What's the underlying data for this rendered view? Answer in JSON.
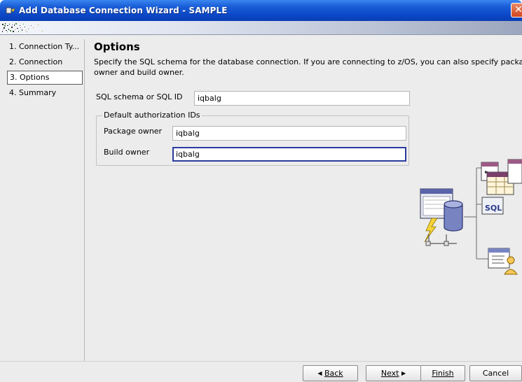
{
  "window": {
    "title": "Add Database Connection Wizard - SAMPLE",
    "close_glyph": "✕"
  },
  "nav": {
    "items": [
      {
        "label": "1. Connection Ty...",
        "selected": false
      },
      {
        "label": "2. Connection",
        "selected": false
      },
      {
        "label": "3. Options",
        "selected": true
      },
      {
        "label": "4. Summary",
        "selected": false
      }
    ]
  },
  "page": {
    "heading": "Options",
    "description": "Specify the SQL schema for the database connection. If you are connecting to z/OS, you can also specify package owner and build owner."
  },
  "form": {
    "schema_label": "SQL schema or SQL ID",
    "schema_value": "iqbalg",
    "group_legend": "Default authorization IDs",
    "package_owner_label": "Package owner",
    "package_owner_value": "iqbalg",
    "build_owner_label": "Build owner",
    "build_owner_value": "iqbalg"
  },
  "buttons": {
    "back": "Back",
    "next": "Next",
    "finish": "Finish",
    "cancel": "Cancel"
  },
  "illustration": {
    "sql_badge": "SQL"
  },
  "colors": {
    "titlebar": "#0b48c8",
    "focus_border": "#2b3b9c",
    "panel_bg": "#ececec"
  }
}
